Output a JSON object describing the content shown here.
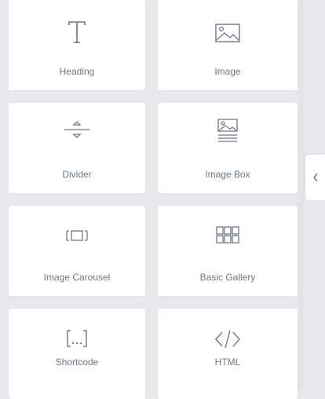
{
  "widgets": [
    {
      "label": "Heading",
      "icon": "heading-icon"
    },
    {
      "label": "Image",
      "icon": "image-icon"
    },
    {
      "label": "Divider",
      "icon": "divider-icon"
    },
    {
      "label": "Image Box",
      "icon": "image-box-icon"
    },
    {
      "label": "Image Carousel",
      "icon": "image-carousel-icon"
    },
    {
      "label": "Basic Gallery",
      "icon": "basic-gallery-icon"
    },
    {
      "label": "Shortcode",
      "icon": "shortcode-icon"
    },
    {
      "label": "HTML",
      "icon": "html-icon"
    }
  ],
  "collapse_toggle": {
    "icon": "chevron-left-icon"
  },
  "colors": {
    "background": "#e6e8ec",
    "card": "#ffffff",
    "label": "#6d7882",
    "icon": "#6d7882"
  }
}
